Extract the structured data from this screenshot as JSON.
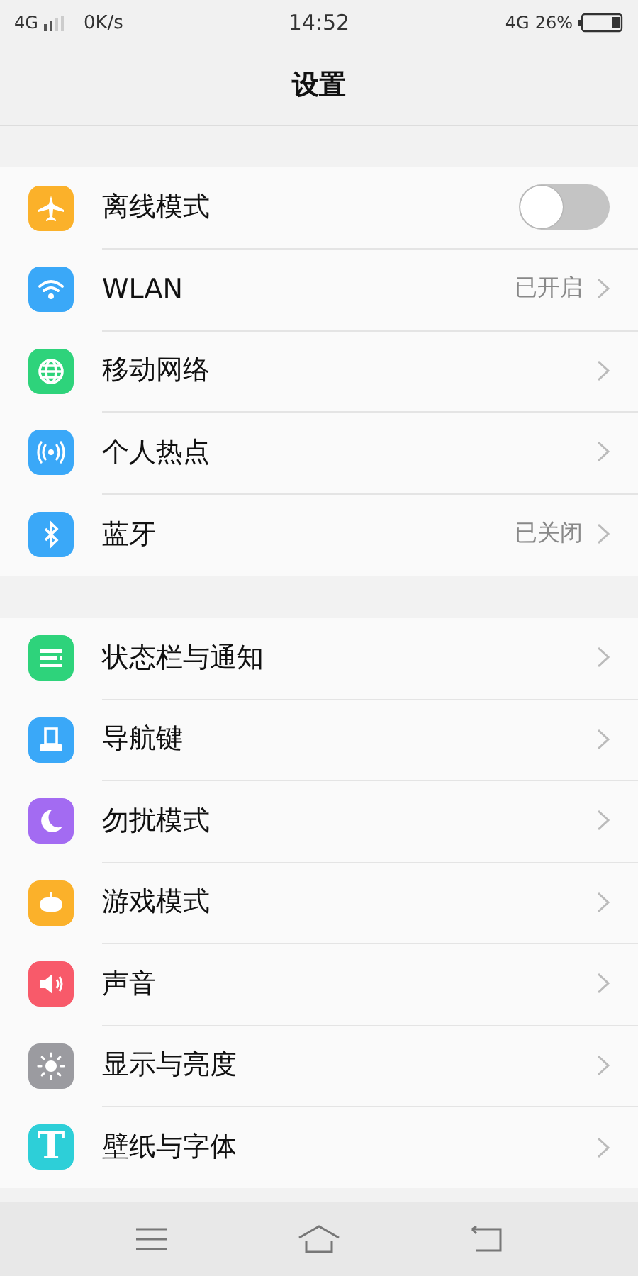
{
  "status_bar": {
    "network": "4G",
    "speed": "0K/s",
    "time": "14:52",
    "network_right": "4G",
    "battery": "26%"
  },
  "title": "设置",
  "groups": [
    {
      "items": [
        {
          "kind": "toggle",
          "label": "离线模式",
          "on": false,
          "color": "#fbb12a"
        },
        {
          "kind": "link",
          "label": "WLAN",
          "value": "已开启",
          "color": "#3aa8f8"
        },
        {
          "kind": "link",
          "label": "移动网络",
          "color": "#2ed37b"
        },
        {
          "kind": "link",
          "label": "个人热点",
          "color": "#3aa8f8"
        },
        {
          "kind": "link",
          "label": "蓝牙",
          "value": "已关闭",
          "color": "#3aa8f8"
        }
      ]
    },
    {
      "items": [
        {
          "kind": "link",
          "label": "状态栏与通知",
          "color": "#2ed37b"
        },
        {
          "kind": "link",
          "label": "导航键",
          "color": "#3aa8f8"
        },
        {
          "kind": "link",
          "label": "勿扰模式",
          "color": "#a36bf2"
        },
        {
          "kind": "link",
          "label": "游戏模式",
          "color": "#fbb12a"
        },
        {
          "kind": "link",
          "label": "声音",
          "color": "#f85a6a"
        },
        {
          "kind": "link",
          "label": "显示与亮度",
          "color": "#9b9ba0"
        },
        {
          "kind": "link",
          "label": "壁纸与字体",
          "color": "#2dcfd8",
          "icon_glyph": "T"
        }
      ]
    }
  ]
}
